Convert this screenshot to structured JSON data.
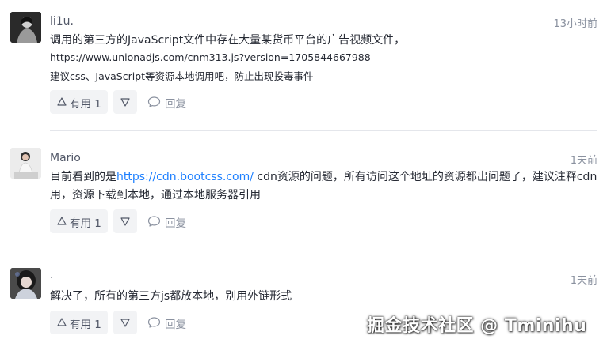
{
  "comments": [
    {
      "username": "li1u.",
      "time": "13小时前",
      "lines": [
        "调用的第三方的JavaScript文件中存在大量某货币平台的广告视频文件，",
        "https://www.unionadjs.com/cnm313.js?version=1705844667988",
        "建议css、JavaScript等资源本地调用吧，防止出现投毒事件"
      ],
      "useful_label": "有用 1",
      "reply_label": "回复"
    },
    {
      "username": "Mario",
      "time": "1天前",
      "line1_before": "目前看到的是",
      "line1_link": "https://cdn.bootcss.com/",
      "line1_after": " cdn资源的问题，所有访问这个地址的资源都出问题了，建议注释cdn引",
      "line2": "用，资源下载到本地，通过本地服务器引用",
      "useful_label": "有用 1",
      "reply_label": "回复"
    },
    {
      "username": ".",
      "time": "1天前",
      "lines": [
        "解决了，所有的第三方js都放本地，别用外链形式"
      ],
      "useful_label": "有用 1",
      "reply_label": "回复"
    }
  ],
  "watermark": "掘金技术社区 @ Tminihu",
  "icons": {
    "upvote": "upvote-triangle-icon",
    "downvote": "downvote-triangle-icon",
    "reply": "comment-bubble-icon"
  },
  "colors": {
    "link": "#1e80ff",
    "muted": "#8a919f",
    "button_bg": "#f2f3f5"
  }
}
